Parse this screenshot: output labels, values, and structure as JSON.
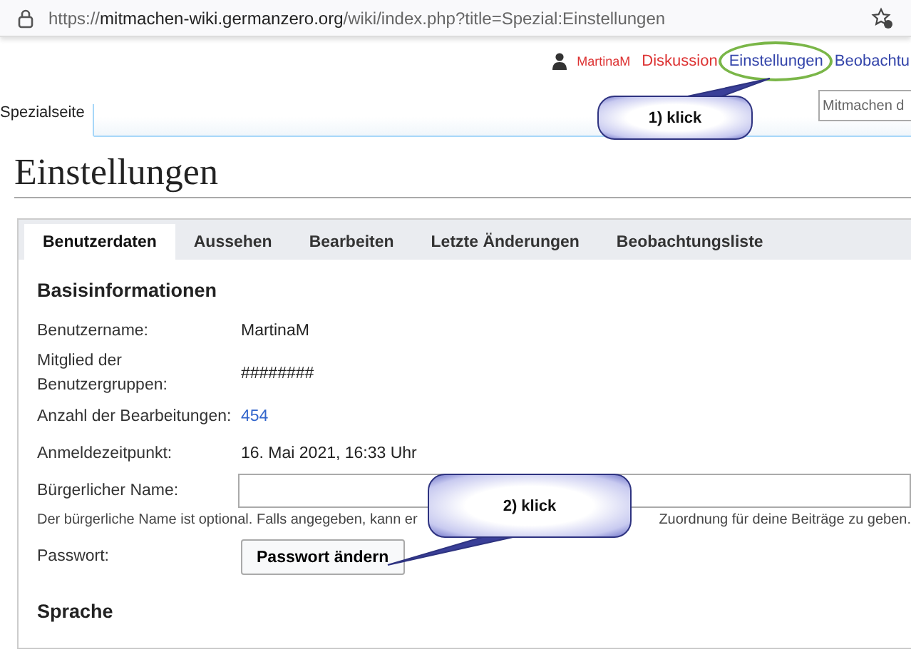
{
  "browser": {
    "url": "https://**mitmachen-wiki.germanzero.org**/wiki/index.php?title=Spezial:Einstellungen"
  },
  "personal_links": [
    {
      "text": "MartinaM",
      "kind": "user",
      "missing": true,
      "circled": false
    },
    {
      "text": "Diskussion",
      "kind": "link",
      "missing": true,
      "circled": false
    },
    {
      "text": "Einstellungen",
      "kind": "link",
      "missing": false,
      "circled": true
    },
    {
      "text": "Beobachtu",
      "kind": "link",
      "missing": false,
      "circled": false
    }
  ],
  "page_tabs": [
    {
      "label": "Spezialseite",
      "selected": true
    }
  ],
  "search": {
    "placeholder": "Mitmachen d"
  },
  "title": "Einstellungen",
  "tabs": [
    {
      "label": "Benutzerdaten",
      "selected": true
    },
    {
      "label": "Aussehen",
      "selected": false
    },
    {
      "label": "Bearbeiten",
      "selected": false
    },
    {
      "label": "Letzte Änderungen",
      "selected": false
    },
    {
      "label": "Beobachtungsliste",
      "selected": false
    }
  ],
  "section": "Basisinformationen",
  "rows": [
    {
      "kind": "text",
      "label": "Benutzername:",
      "value": "MartinaM"
    },
    {
      "kind": "text",
      "label": "Mitglied der Benutzergruppen:",
      "value": "########"
    },
    {
      "kind": "link",
      "label": "Anzahl der Bearbeitungen:",
      "value": "454"
    },
    {
      "kind": "text",
      "label": "Anmeldezeitpunkt:",
      "value": "16. Mai 2021, 16:33 Uhr"
    },
    {
      "kind": "field",
      "label": "Bürgerlicher Name:",
      "help": [
        "Der bürgerliche Name ist optional. Falls angegeben, kann er",
        "Zuordnung für deine Beiträge zu geben."
      ]
    },
    {
      "kind": "button",
      "label": "Passwort:",
      "value": "Passwort ändern"
    }
  ],
  "section_2": "Sprache",
  "callouts": [
    {
      "text": "1) klick"
    },
    {
      "text": "2) klick"
    }
  ]
}
